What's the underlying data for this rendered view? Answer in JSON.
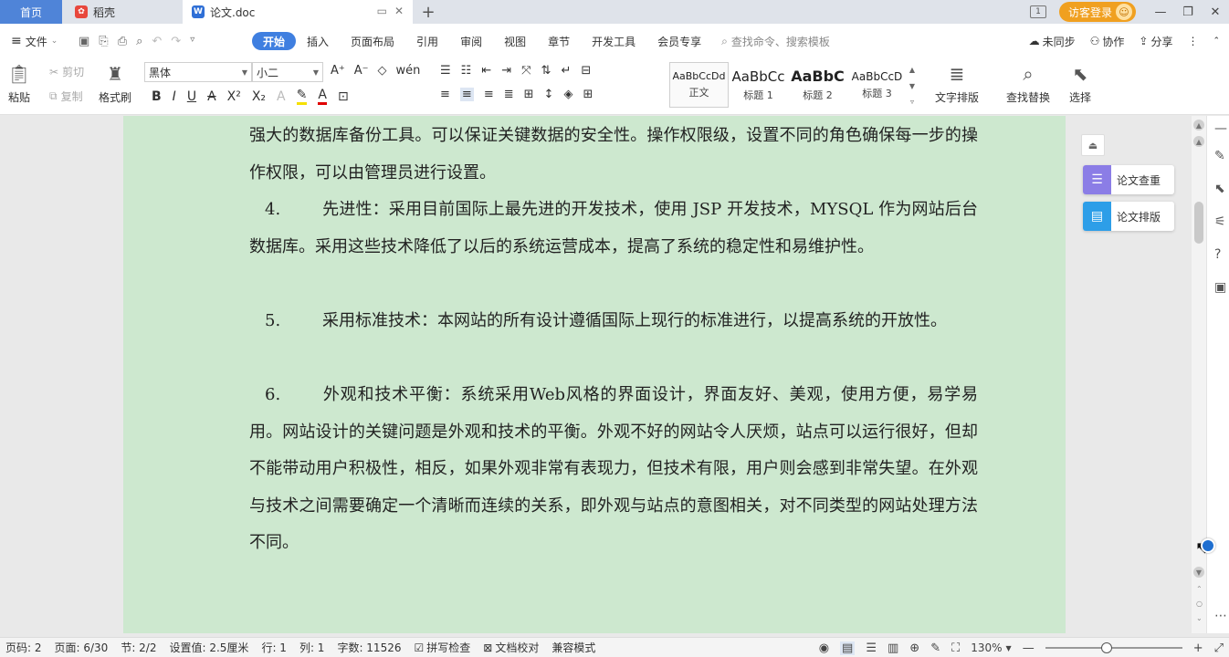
{
  "tabs": {
    "home": "首页",
    "daoke": "稻壳",
    "doc": "论文.doc",
    "new_tab": "+"
  },
  "titlebar": {
    "login": "访客登录",
    "badge": "1",
    "minimize": "—",
    "restore": "❐",
    "close": "✕"
  },
  "menubar": {
    "file": "文件",
    "items": [
      "开始",
      "插入",
      "页面布局",
      "引用",
      "审阅",
      "视图",
      "章节",
      "开发工具",
      "会员专享"
    ],
    "search_placeholder": "查找命令、搜索模板",
    "right": [
      "未同步",
      "协作",
      "分享"
    ]
  },
  "ribbon": {
    "paste": "粘贴",
    "cut": "剪切",
    "copy": "复制",
    "format_painter": "格式刷",
    "font_name": "黑体",
    "font_size": "小二",
    "styles": [
      {
        "sample": "AaBbCcDd",
        "name": "正文"
      },
      {
        "sample": "AaBbCc",
        "name": "标题 1"
      },
      {
        "sample": "AaBbC",
        "name": "标题 2"
      },
      {
        "sample": "AaBbCcD",
        "name": "标题 3"
      }
    ],
    "text_layout": "文字排版",
    "find_replace": "查找替换",
    "select": "选择"
  },
  "document": {
    "paragraphs": [
      {
        "num": "",
        "text": "强大的数据库备份工具。可以保证关键数据的安全性。操作权限级，设置不同的角色确保每一步的操作权限，可以由管理员进行设置。"
      },
      {
        "num": "4.",
        "text": "先进性：采用目前国际上最先进的开发技术，使用 JSP 开发技术，MYSQL 作为网站后台数据库。采用这些技术降低了以后的系统运营成本，提高了系统的稳定性和易维护性。"
      },
      {
        "num": "5.",
        "text": "采用标准技术：本网站的所有设计遵循国际上现行的标准进行，以提高系统的开放性。"
      },
      {
        "num": "6.",
        "text": "外观和技术平衡：系统采用Web风格的界面设计，界面友好、美观，使用方便，易学易用。网站设计的关键问题是外观和技术的平衡。外观不好的网站令人厌烦，站点可以运行很好，但却不能带动用户积极性，相反，如果外观非常有表现力，但技术有限，用户则会感到非常失望。在外观与技术之间需要确定一个清晰而连续的关系，即外观与站点的意图相关，对不同类型的网站处理方法不同。"
      }
    ]
  },
  "float_panel": {
    "plagiarism_check": "论文查重",
    "paper_format": "论文排版"
  },
  "statusbar": {
    "page_code": "页码: 2",
    "page": "页面: 6/30",
    "section": "节: 2/2",
    "setting": "设置值: 2.5厘米",
    "row": "行: 1",
    "col": "列: 1",
    "word_count": "字数: 11526",
    "spell_check": "拼写检查",
    "doc_proof": "文档校对",
    "compat_mode": "兼容模式",
    "zoom": "130%",
    "zoom_fraction": 0.45
  },
  "colors": {
    "accent": "#3f7fe0",
    "page_bg": "#cde8cf",
    "login": "#f0a020"
  }
}
